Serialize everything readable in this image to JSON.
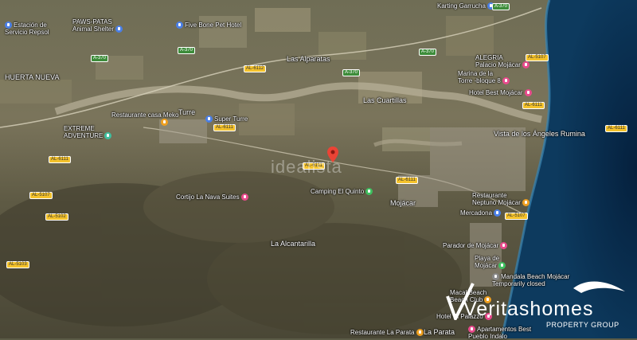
{
  "map": {
    "places": [
      {
        "id": "repsol",
        "text": "Estación de\nServicio Repsol",
        "icon": "gas-station-icon",
        "color": "#4a7fe6"
      },
      {
        "id": "paws",
        "text": "PAWS-PATAS\nAnimal Shelter",
        "icon": "pet-icon",
        "color": "#4a7fe6"
      },
      {
        "id": "fivebone",
        "text": "Five Bone Pet Hotel",
        "icon": "pet-icon",
        "color": "#4a7fe6"
      },
      {
        "id": "karting",
        "text": "Karting Garrucha",
        "icon": "karting-icon",
        "color": "#4a7fe6"
      },
      {
        "id": "huerta",
        "text": "HUERTA NUEVA"
      },
      {
        "id": "alparatas",
        "text": "Las Alparatas"
      },
      {
        "id": "cuartillas",
        "text": "Las Cuartillas"
      },
      {
        "id": "alegria",
        "text": "ALEGRIA\nPalacio Mojácar",
        "icon": "hotel-icon",
        "color": "#e84a8c"
      },
      {
        "id": "marina",
        "text": "Marina de la\nTorre -bloque 8",
        "icon": "hotel-icon",
        "color": "#e84a8c"
      },
      {
        "id": "hotelbest",
        "text": "Hotel Best Mojácar",
        "icon": "hotel-icon",
        "color": "#e84a8c"
      },
      {
        "id": "meko",
        "text": "Restaurante casa Meko",
        "icon": "restaurant-icon",
        "color": "#f0a020"
      },
      {
        "id": "turre",
        "text": "Turre"
      },
      {
        "id": "superturre",
        "text": "Super Turre",
        "icon": "shop-icon",
        "color": "#4a7fe6"
      },
      {
        "id": "extreme",
        "text": "EXTREME\nADVENTURE",
        "icon": "adventure-icon",
        "color": "#3fbf9f"
      },
      {
        "id": "vista",
        "text": "Vista de los\nÁngeles Rumina"
      },
      {
        "id": "camping",
        "text": "Camping El Quinto",
        "icon": "camping-icon",
        "color": "#3fbf5f"
      },
      {
        "id": "corijo",
        "text": "Cortijo La Nava Suites",
        "icon": "hotel-icon",
        "color": "#e84a8c"
      },
      {
        "id": "mojacar",
        "text": "Mojácar"
      },
      {
        "id": "neptuno",
        "text": "Restaurante\nNeptuno Mojácar",
        "icon": "restaurant-icon",
        "color": "#f0a020"
      },
      {
        "id": "mercadona",
        "text": "Mercadona",
        "icon": "shop-icon",
        "color": "#4a7fe6"
      },
      {
        "id": "alcantarilla",
        "text": "La Alcantarilla"
      },
      {
        "id": "parador",
        "text": "Parador de Mojácar",
        "icon": "hotel-icon",
        "color": "#e84a8c"
      },
      {
        "id": "playa",
        "text": "Playa de\nMojácar",
        "icon": "beach-icon",
        "color": "#3fbf5f"
      },
      {
        "id": "mandala",
        "text": "Mandala Beach Mojácar\nTemporarily closed",
        "icon": "place-icon",
        "color": "#888888"
      },
      {
        "id": "macbeach",
        "text": "Macal Beach\nBeach Club",
        "icon": "restaurant-icon",
        "color": "#f0a020"
      },
      {
        "id": "palazzo",
        "text": "Hotel El Palazzo",
        "icon": "hotel-icon",
        "color": "#e84a8c"
      },
      {
        "id": "laparata",
        "text": "Restaurante La Parata",
        "icon": "restaurant-icon",
        "color": "#f0a020"
      },
      {
        "id": "laparata2",
        "text": "La Parata"
      },
      {
        "id": "apartbest",
        "text": "Apartamentos Best\nPueblo Indalo",
        "icon": "hotel-icon",
        "color": "#e84a8c"
      }
    ],
    "roads": [
      "A-370",
      "A-370",
      "A-370",
      "AL-6111",
      "AL-6111",
      "AL-6111",
      "AL-6112",
      "AL-5107",
      "AL-6111",
      "AL-5102",
      "AL-5103",
      "AL-5107",
      "AL-5107",
      "A-370",
      "A-370",
      "AL-6111",
      "AL-6111"
    ],
    "watermark": "idealista",
    "marker_color": "#ea4335"
  },
  "brand": {
    "name": "Veritashomes",
    "tagline": "PROPERTY GROUP"
  }
}
